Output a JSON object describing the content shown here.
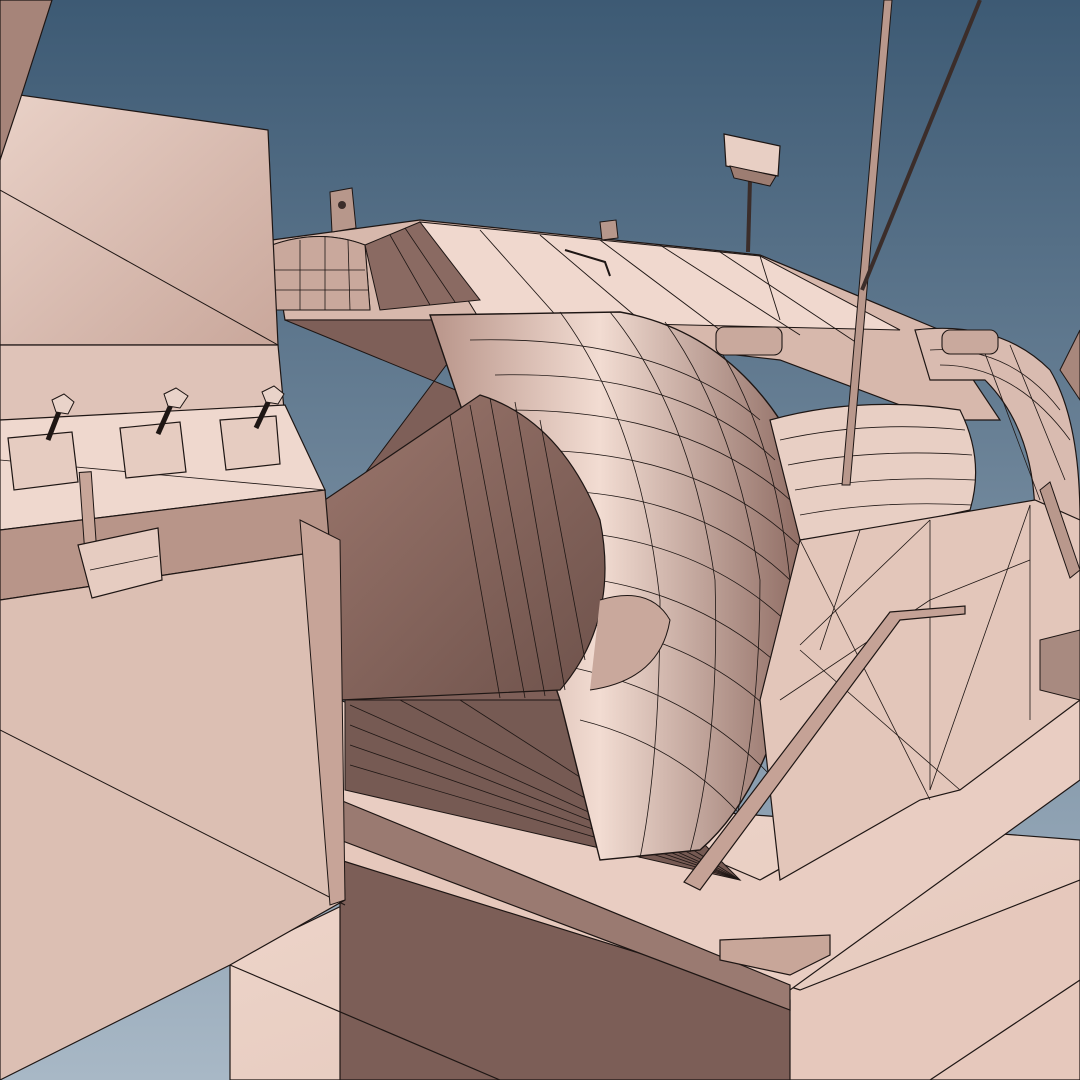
{
  "scene": {
    "subject": "wireframe-render-3d-machinery",
    "colors": {
      "sky_top": "#3d5a74",
      "sky_bottom": "#9fb2c2",
      "mesh_light": "#f0d8cf",
      "mesh_mid": "#d8b8ad",
      "mesh_shadow": "#7a5c55",
      "mesh_dark": "#5e443f",
      "wire": "#1e1614"
    },
    "lever_count": 4
  }
}
